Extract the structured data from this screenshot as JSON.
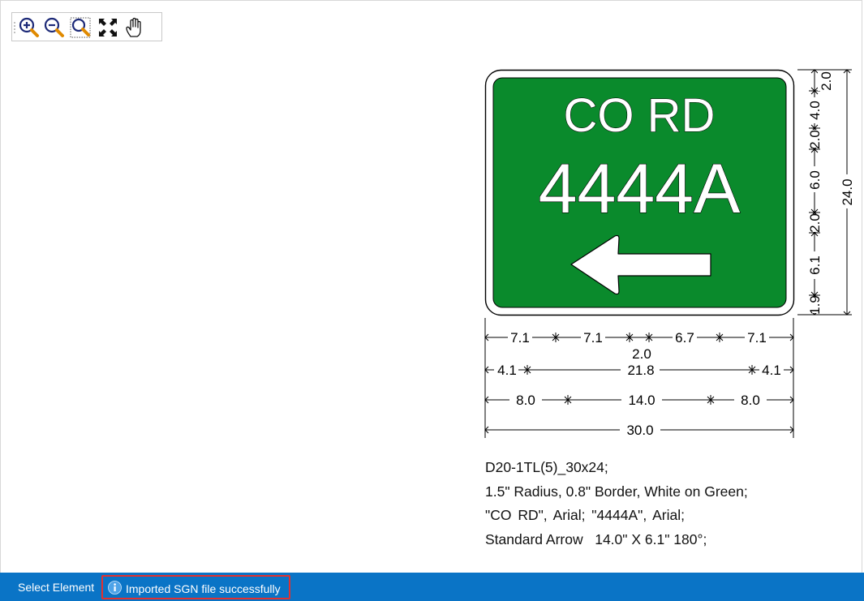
{
  "toolbar": {
    "buttons": [
      {
        "name": "zoom-in-icon"
      },
      {
        "name": "zoom-out-icon"
      },
      {
        "name": "zoom-window-icon"
      },
      {
        "name": "zoom-extents-icon"
      },
      {
        "name": "pan-hand-icon"
      }
    ]
  },
  "sign": {
    "line1": "CO RD",
    "line2": "4444A",
    "colors": {
      "background": "#0a8a2c",
      "legend": "#ffffff",
      "border": "#ffffff",
      "outline": "#000000"
    }
  },
  "dimensions": {
    "vertical": {
      "segments": [
        "2.0",
        "4.0",
        "2.0",
        "6.0",
        "2.0",
        "6.1",
        "1.9"
      ],
      "total": "24.0"
    },
    "horizontal_row1": [
      "7.1",
      "7.1",
      "2.0",
      "6.7",
      "7.1"
    ],
    "horizontal_row2": [
      "4.1",
      "21.8",
      "4.1"
    ],
    "horizontal_row3": [
      "8.0",
      "14.0",
      "8.0"
    ],
    "horizontal_total": "30.0"
  },
  "spec": {
    "line1": "D20-1TL(5)_30x24;",
    "line2": "1.5\" Radius, 0.8\" Border, White on Green;",
    "line3": "\"CO RD\", Arial; \"4444A\", Arial;",
    "line4": "Standard Arrow   14.0\" X 6.1\" 180°;"
  },
  "statusbar": {
    "left_label": "Select Element",
    "message": "Imported SGN file successfully",
    "bg_color": "#0a74c6",
    "highlight_color": "#e2312f"
  }
}
